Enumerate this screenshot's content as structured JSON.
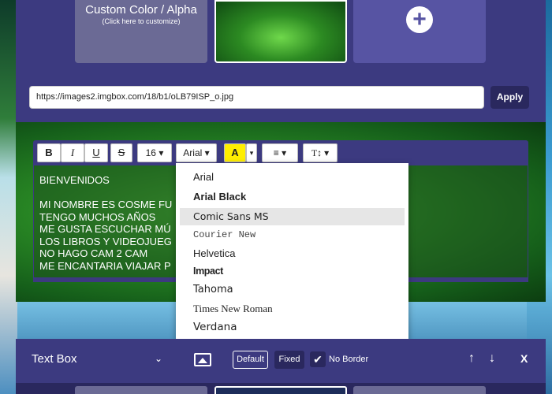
{
  "background_tiles": {
    "custom_color_title": "Custom Color / Alpha",
    "custom_color_hint": "(Click here to customize)",
    "add_icon": "plus-icon"
  },
  "url_bar": {
    "value": "https://images2.imgbox.com/18/b1/oLB79ISP_o.jpg",
    "apply_label": "Apply"
  },
  "toolbar": {
    "bold_label": "B",
    "italic_label": "I",
    "underline_label": "U",
    "strike_label": "S",
    "font_size": "16",
    "font_family": "Arial",
    "color_label": "A",
    "align_icon": "align-icon",
    "text_tool_label": "T"
  },
  "editor": {
    "lines": [
      "BIENVENIDOS",
      "",
      "MI NOMBRE ES COSME FU",
      "TENGO MUCHOS AÑOS",
      "ME GUSTA ESCUCHAR MÚ",
      "LOS LIBROS Y VIDEOJUEG",
      "NO HAGO CAM 2 CAM",
      "ME ENCANTARIA VIAJAR P"
    ]
  },
  "font_dropdown": {
    "options": [
      "Arial",
      "Arial Black",
      "Comic Sans MS",
      "Courier New",
      "Helvetica",
      "Impact",
      "Tahoma",
      "Times New Roman",
      "Verdana"
    ],
    "hovered": "Comic Sans MS"
  },
  "footer": {
    "box_label": "Text Box",
    "default_label": "Default",
    "fixed_label": "Fixed",
    "no_border_label": "No Border",
    "close_label": "X"
  },
  "colors": {
    "panel": "#3c3a80",
    "dark_button": "#2a285e",
    "highlight_yellow": "#ffee00"
  }
}
